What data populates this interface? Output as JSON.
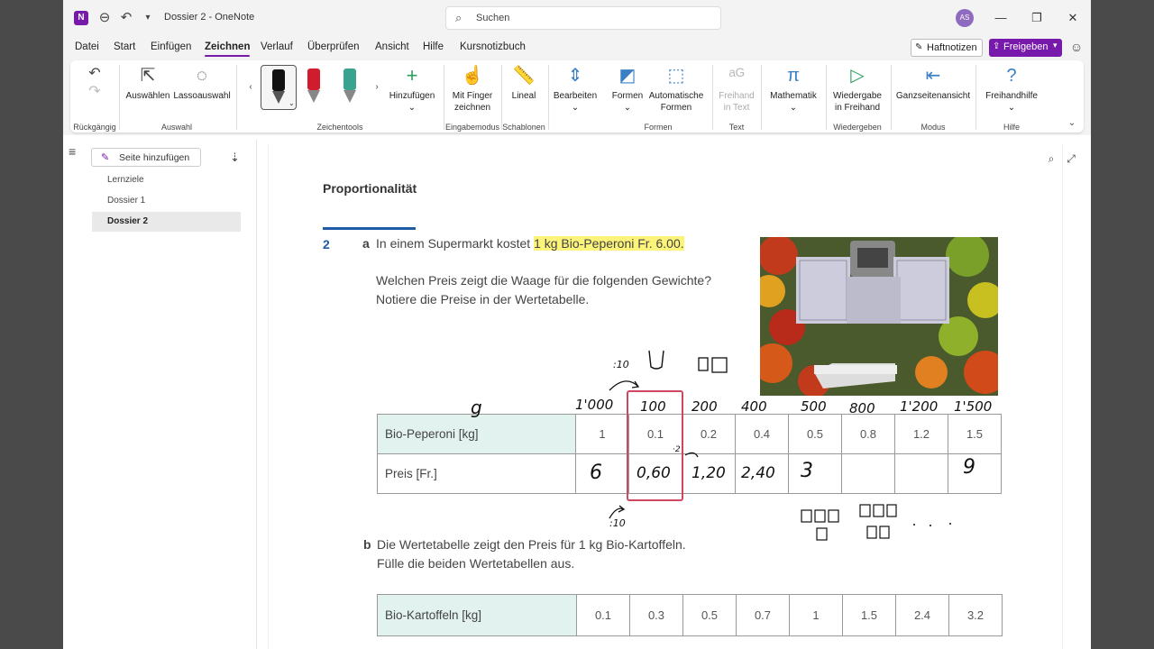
{
  "window": {
    "title": "Dossier 2 - OneNote",
    "app_icon": "N"
  },
  "search": {
    "placeholder": "Suchen"
  },
  "user": {
    "initials": "AS"
  },
  "menu": {
    "tabs": [
      "Datei",
      "Start",
      "Einfügen",
      "Zeichnen",
      "Verlauf",
      "Überprüfen",
      "Ansicht",
      "Hilfe",
      "Kursnotizbuch"
    ],
    "active": "Zeichnen",
    "haftnotizen": "Haftnotizen",
    "freigeben": "Freigeben"
  },
  "ribbon": {
    "auswaehlen": "Auswählen",
    "lasso": "Lassoauswahl",
    "hinzufuegen": "Hinzufügen",
    "finger": [
      "Mit Finger",
      "zeichnen"
    ],
    "lineal": "Lineal",
    "bearbeiten": "Bearbeiten",
    "formen": "Formen",
    "auto_formen": [
      "Automatische",
      "Formen"
    ],
    "freihand_text": [
      "Freihand",
      "in Text"
    ],
    "mathematik": "Mathematik",
    "wiedergabe": [
      "Wiedergabe",
      "in Freihand"
    ],
    "ganzseiten": "Ganzseitenansicht",
    "freihandhilfe": "Freihandhilfe",
    "groups": {
      "rueckgaengig": "Rückgängig",
      "auswahl": "Auswahl",
      "zeichentools": "Zeichentools",
      "eingabemodus": "Eingabemodus",
      "schablonen": "Schablonen",
      "formen": "Formen",
      "text": "Text",
      "wiedergeben": "Wiedergeben",
      "modus": "Modus",
      "hilfe": "Hilfe"
    },
    "pen_colors": [
      "#111111",
      "#d01c2c",
      "#3aa390"
    ]
  },
  "pages": {
    "add_label": "Seite hinzufügen",
    "items": [
      "Lernziele",
      "Dossier 1",
      "Dossier 2"
    ],
    "active": "Dossier 2"
  },
  "document": {
    "title": "Proportionalität",
    "task_number": "2",
    "a_label": "a",
    "a_line1_pre": "In einem Supermarkt kostet ",
    "a_line1_hl": "1 kg Bio-Peperoni Fr. 6.00.",
    "a_line2": "Welchen Preis zeigt die Waage für die folgenden Gewichte?",
    "a_line3": "Notiere die Preise in der Wertetabelle.",
    "b_label": "b",
    "b_line1": "Die Wertetabelle zeigt den Preis für 1 kg Bio-Kartoffeln.",
    "b_line2": "Fülle die beiden Wertetabellen aus.",
    "table1": {
      "row1_label": "Bio-Peperoni [kg]",
      "row1": [
        "1",
        "0.1",
        "0.2",
        "0.4",
        "0.5",
        "0.8",
        "1.2",
        "1.5"
      ],
      "row2_label": "Preis [Fr.]"
    },
    "table2": {
      "row1_label": "Bio-Kartoffeln [kg]",
      "row1": [
        "0.1",
        "0.3",
        "0.5",
        "0.7",
        "1",
        "1.5",
        "2.4",
        "3.2"
      ]
    }
  },
  "handwriting": {
    "g": "g",
    "grams": [
      "1'000",
      "100",
      "200",
      "400",
      "500",
      "800",
      "1'200",
      "1'500"
    ],
    "prices": [
      "6",
      "0,60",
      "1,20",
      "2,40",
      "3",
      "",
      "",
      "9"
    ],
    "div10_top": ":10",
    "div10_bottom": ":10",
    "times2": "·2"
  }
}
